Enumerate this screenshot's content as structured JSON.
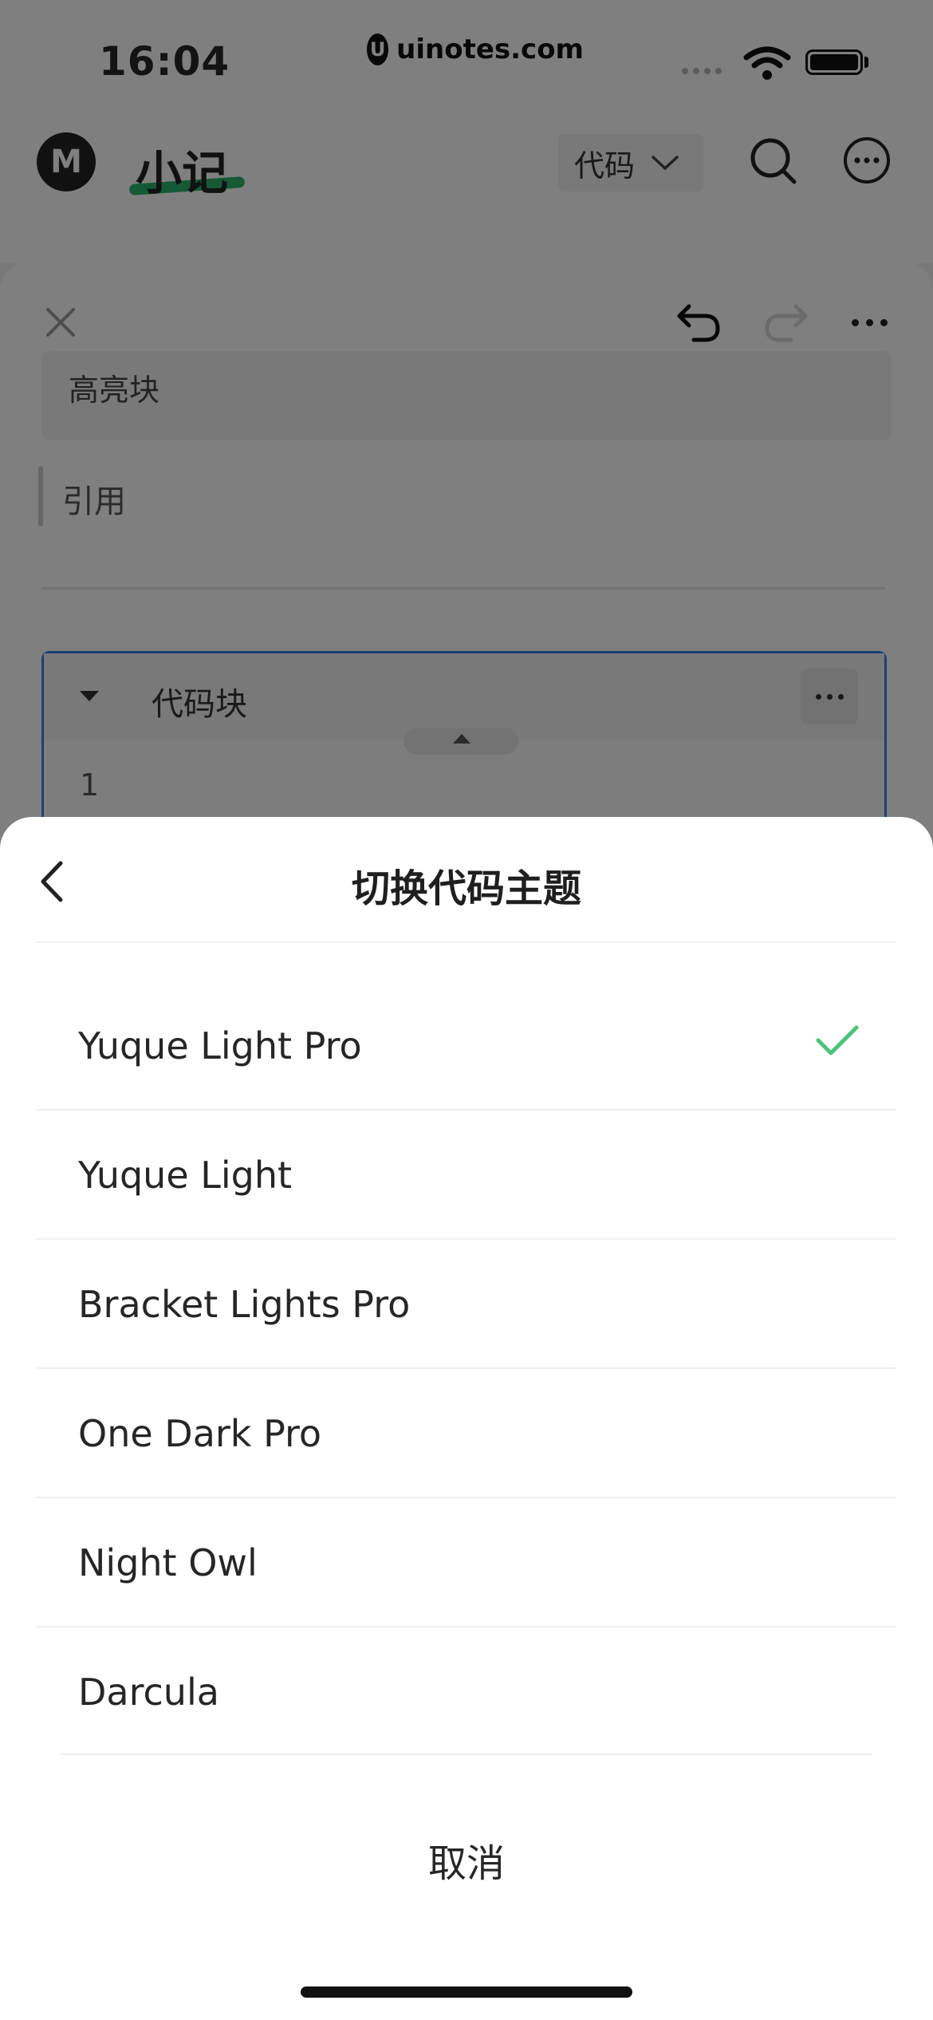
{
  "status_bar": {
    "time": "16:04",
    "site": "uinotes.com",
    "site_badge": "U"
  },
  "app_header": {
    "logo_letter": "M",
    "title": "小记",
    "dropdown_label": "代码"
  },
  "editor": {
    "highlight_block_text": "高亮块",
    "quote_text": "引用",
    "code_block": {
      "title": "代码块",
      "line_number": "1"
    }
  },
  "sheet": {
    "title": "切换代码主题",
    "options": [
      {
        "label": "Yuque Light Pro",
        "selected": true
      },
      {
        "label": "Yuque Light",
        "selected": false
      },
      {
        "label": "Bracket Lights Pro",
        "selected": false
      },
      {
        "label": "One Dark Pro",
        "selected": false
      },
      {
        "label": "Night Owl",
        "selected": false
      },
      {
        "label": "Darcula",
        "selected": false
      }
    ],
    "cancel_label": "取消"
  },
  "colors": {
    "accent_green": "#2bb36e",
    "code_block_border": "#3b7ff1",
    "check_color": "#4cc27a"
  }
}
